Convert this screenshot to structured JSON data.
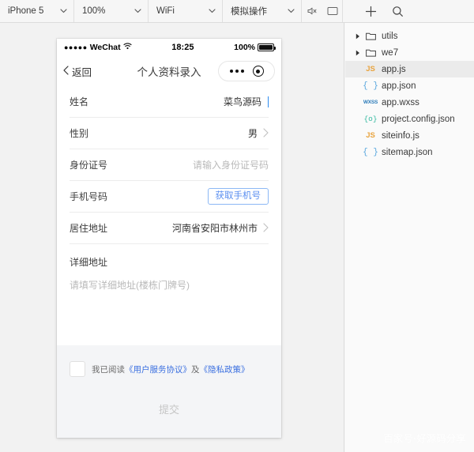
{
  "toolbar": {
    "device": "iPhone 5",
    "zoom": "100%",
    "network": "WiFi",
    "simulate": "模拟操作",
    "mute_icon": "speaker-mute-icon",
    "screen_icon": "screen-icon",
    "add_icon": "plus-icon",
    "search_icon": "search-icon",
    "caret_icon": "chevron-down-icon"
  },
  "phone": {
    "statusbar": {
      "signal_dots": "●●●●●",
      "carrier": "WeChat",
      "wifi_icon": "wifi-icon",
      "time": "18:25",
      "battery_text": "100%"
    },
    "navbar": {
      "back_icon": "chevron-left-icon",
      "back_label": "返回",
      "title": "个人资料录入",
      "capsule_more_icon": "more-dots-icon",
      "capsule_target_icon": "target-icon"
    },
    "form": {
      "rows": [
        {
          "label": "姓名",
          "value": "菜鸟源码",
          "type": "text-filled"
        },
        {
          "label": "性别",
          "value": "男",
          "type": "picker"
        },
        {
          "label": "身份证号",
          "value": "请输入身份证号码",
          "type": "text-placeholder"
        },
        {
          "label": "手机号码",
          "value": "获取手机号",
          "type": "button"
        },
        {
          "label": "居住地址",
          "value": "河南省安阳市林州市",
          "type": "picker"
        }
      ],
      "detail_address": {
        "label": "详细地址",
        "placeholder": "请填写详细地址(楼栋门牌号)"
      },
      "agreement": {
        "prefix": "我已阅读",
        "link1": "《用户服务协议》",
        "conjunction": "及",
        "link2": "《隐私政策》",
        "checkbox_state": "unchecked"
      },
      "submit_label": "提交"
    }
  },
  "files": {
    "items": [
      {
        "name": "utils",
        "kind": "folder",
        "arrow": "▶",
        "indent": 0,
        "selected": false,
        "icon": "folder-icon",
        "glyph": ""
      },
      {
        "name": "we7",
        "kind": "folder",
        "arrow": "▶",
        "indent": 0,
        "selected": false,
        "icon": "folder-icon",
        "glyph": ""
      },
      {
        "name": "app.js",
        "kind": "js",
        "arrow": "",
        "indent": 1,
        "selected": true,
        "icon": "js-file-icon",
        "glyph": "JS"
      },
      {
        "name": "app.json",
        "kind": "json",
        "arrow": "",
        "indent": 1,
        "selected": false,
        "icon": "json-file-icon",
        "glyph": "{ }"
      },
      {
        "name": "app.wxss",
        "kind": "wxss",
        "arrow": "",
        "indent": 1,
        "selected": false,
        "icon": "wxss-file-icon",
        "glyph": "WXSS"
      },
      {
        "name": "project.config.json",
        "kind": "cfg",
        "arrow": "",
        "indent": 1,
        "selected": false,
        "icon": "config-file-icon",
        "glyph": "{o}"
      },
      {
        "name": "siteinfo.js",
        "kind": "js",
        "arrow": "",
        "indent": 1,
        "selected": false,
        "icon": "js-file-icon",
        "glyph": "JS"
      },
      {
        "name": "sitemap.json",
        "kind": "json",
        "arrow": "",
        "indent": 1,
        "selected": false,
        "icon": "json-file-icon",
        "glyph": "{ }"
      }
    ]
  },
  "watermark": "百家号·好源码分享",
  "colors": {
    "accent_blue": "#5b8ff0",
    "link_blue": "#3a6fe0",
    "js_orange": "#e8a33d",
    "json_blue": "#5aa7de",
    "wxss_blue": "#2b7bb9",
    "config_green": "#35b9a0",
    "selected_row": "#ebebeb",
    "screen_bg": "#f4f5f7"
  }
}
